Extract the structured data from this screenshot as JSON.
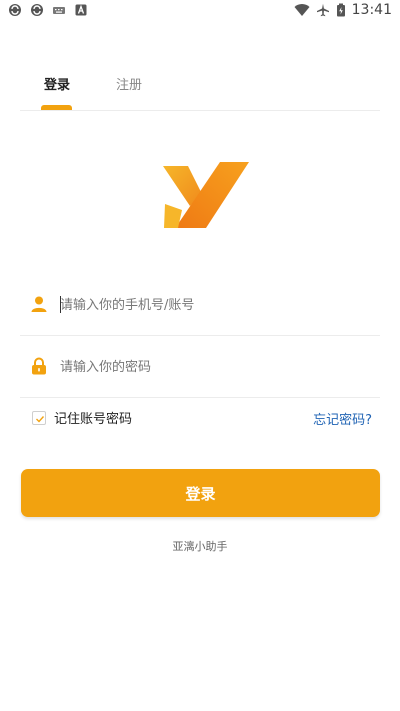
{
  "status_bar": {
    "time": "13:41",
    "left_icons": [
      "sync-icon",
      "sync-icon",
      "keyboard-icon",
      "a-badge-icon"
    ],
    "right_icons": [
      "wifi-icon",
      "airplane-icon",
      "battery-icon"
    ]
  },
  "tabs": [
    {
      "label": "登录",
      "active": true
    },
    {
      "label": "注册",
      "active": false
    }
  ],
  "form": {
    "account_placeholder": "请输入你的手机号/账号",
    "password_placeholder": "请输入你的密码",
    "remember_label": "记住账号密码",
    "remember_checked": true,
    "forgot_label": "忘记密码?"
  },
  "login_button_label": "登录",
  "footer_text": "亚漓小助手",
  "colors": {
    "accent": "#f2a20f",
    "link": "#1f63b4",
    "logo_orange": "#f08a1c",
    "logo_yellow": "#f6b62a"
  }
}
